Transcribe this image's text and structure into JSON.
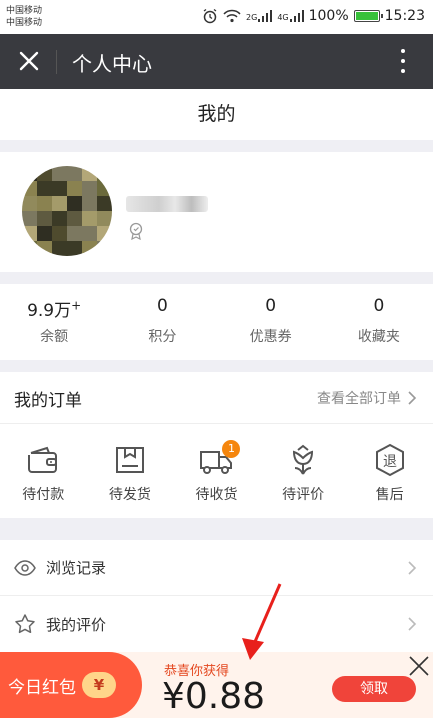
{
  "status_bar": {
    "carrier_line1": "中国移动",
    "carrier_line2": "中国移动",
    "net1": "2G",
    "net2": "4G",
    "battery": "100%",
    "time": "15:23"
  },
  "titlebar": {
    "title": "个人中心"
  },
  "header": {
    "title": "我的"
  },
  "stats": [
    {
      "value": "9.9万",
      "sup": "+",
      "label": "余额"
    },
    {
      "value": "0",
      "sup": "",
      "label": "积分"
    },
    {
      "value": "0",
      "sup": "",
      "label": "优惠券"
    },
    {
      "value": "0",
      "sup": "",
      "label": "收藏夹"
    }
  ],
  "orders": {
    "title": "我的订单",
    "view_all": "查看全部订单",
    "items": [
      {
        "label": "待付款",
        "icon": "wallet-icon"
      },
      {
        "label": "待发货",
        "icon": "package-icon"
      },
      {
        "label": "待收货",
        "icon": "truck-icon",
        "badge": "1"
      },
      {
        "label": "待评价",
        "icon": "flower-icon"
      },
      {
        "label": "售后",
        "icon": "return-icon",
        "glyph": "退"
      }
    ]
  },
  "menu": [
    {
      "label": "浏览记录",
      "icon": "eye-icon"
    },
    {
      "label": "我的评价",
      "icon": "star-icon"
    }
  ],
  "banner": {
    "left_label": "今日红包",
    "coin": "¥",
    "congrats": "恭喜你获得",
    "amount": "¥0.88",
    "button": "领取"
  },
  "colors": {
    "titlebar_bg": "#393a3f",
    "accent_red": "#f0443a",
    "badge_orange": "#f5860d",
    "banner_left": "#ff5a3c"
  }
}
